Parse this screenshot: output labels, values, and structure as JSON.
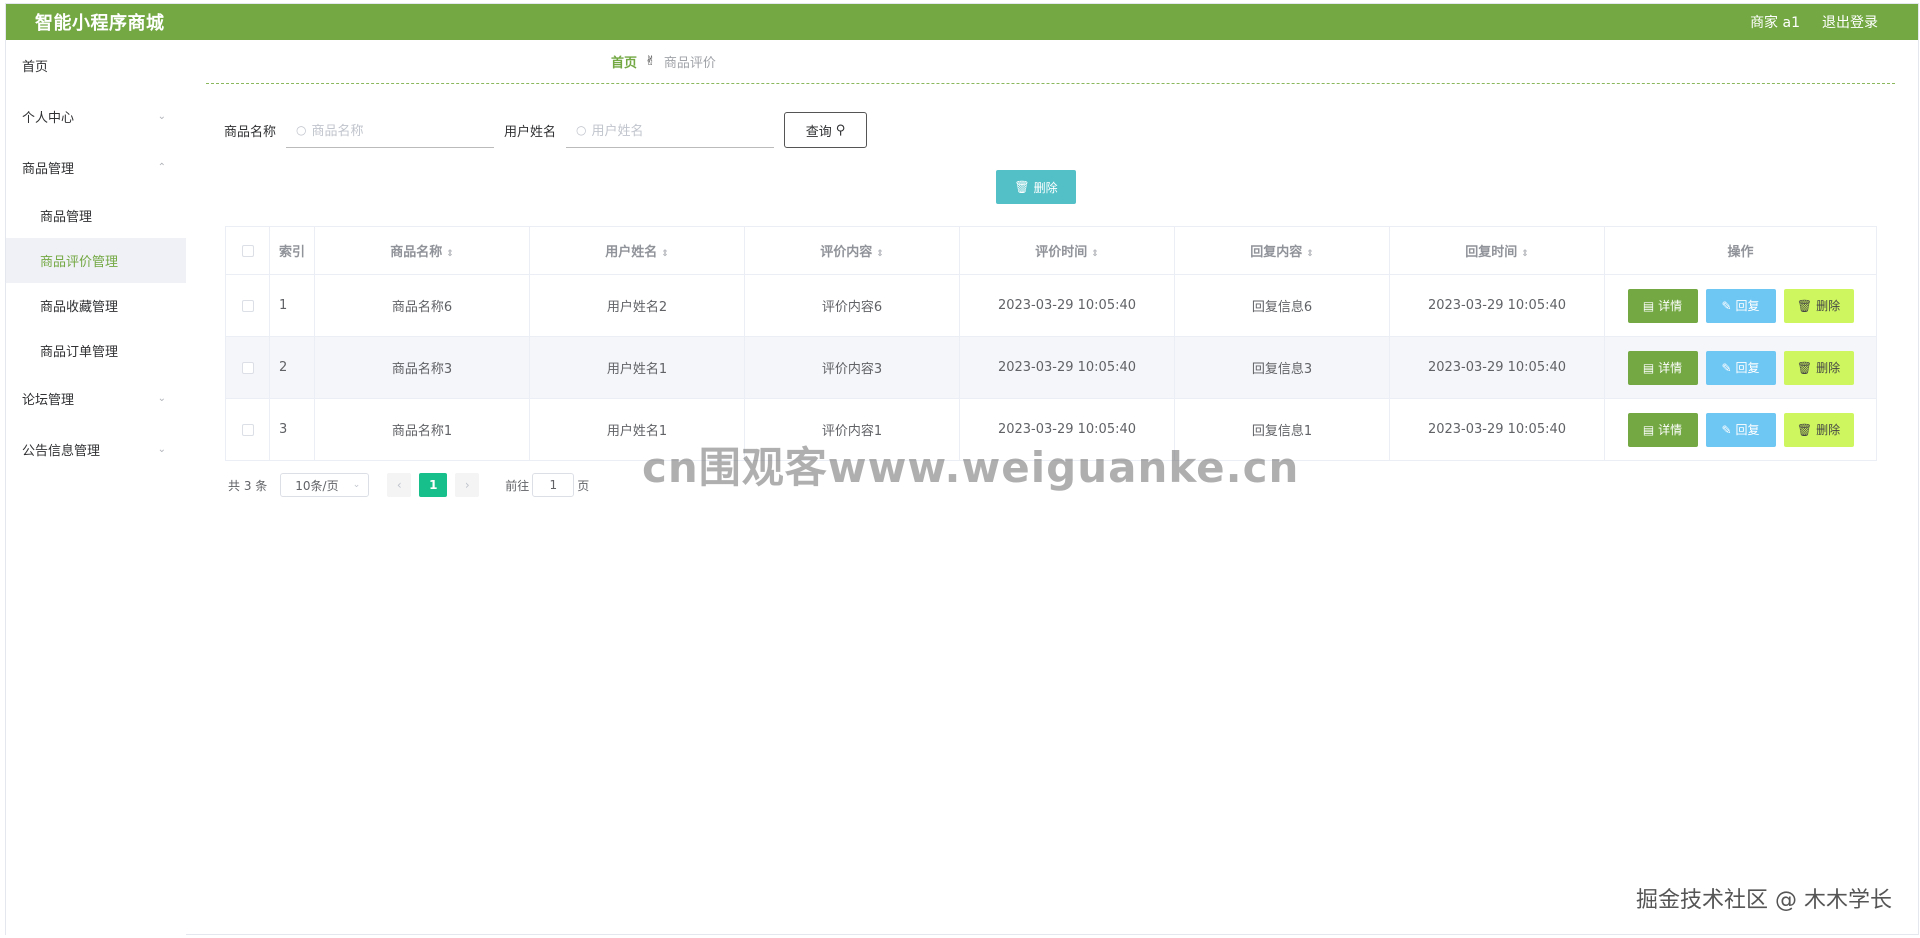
{
  "header": {
    "title": "智能小程序商城",
    "user": "商家 a1",
    "logout": "退出登录"
  },
  "sidebar": {
    "home": "首页",
    "personal": "个人中心",
    "goods_group": "商品管理",
    "goods_sub": [
      "商品管理",
      "商品评价管理",
      "商品收藏管理",
      "商品订单管理"
    ],
    "forum": "论坛管理",
    "notice": "公告信息管理"
  },
  "breadcrumb": {
    "home": "首页",
    "current": "商品评价",
    "sep_icon": "hand-icon"
  },
  "search": {
    "goods_label": "商品名称",
    "goods_placeholder": "商品名称",
    "user_label": "用户姓名",
    "user_placeholder": "用户姓名",
    "query": "查询"
  },
  "actions": {
    "delete": "删除"
  },
  "table": {
    "headers": [
      "索引",
      "商品名称",
      "用户姓名",
      "评价内容",
      "评价时间",
      "回复内容",
      "回复时间",
      "操作"
    ],
    "rows": [
      [
        "1",
        "商品名称6",
        "用户姓名2",
        "评价内容6",
        "2023-03-29 10:05:40",
        "回复信息6",
        "2023-03-29 10:05:40"
      ],
      [
        "2",
        "商品名称3",
        "用户姓名1",
        "评价内容3",
        "2023-03-29 10:05:40",
        "回复信息3",
        "2023-03-29 10:05:40"
      ],
      [
        "3",
        "商品名称1",
        "用户姓名1",
        "评价内容1",
        "2023-03-29 10:05:40",
        "回复信息1",
        "2023-03-29 10:05:40"
      ]
    ],
    "ops": {
      "detail": "详情",
      "reply": "回复",
      "delete": "删除"
    }
  },
  "pagination": {
    "total": "共 3 条",
    "page_size": "10条/页",
    "current": "1",
    "goto": "前往",
    "page": "页",
    "goto_value": "1"
  },
  "watermark": "cn围观客www.weiguanke.cn",
  "credit": "掘金技术社区 @ 木木学长",
  "colors": {
    "header": "#73a843",
    "primary": "#73a843",
    "delete_top": "#53c0c8",
    "reply": "#6ec6f3",
    "delete": "#cef75f",
    "page_active": "#17bf8a"
  }
}
